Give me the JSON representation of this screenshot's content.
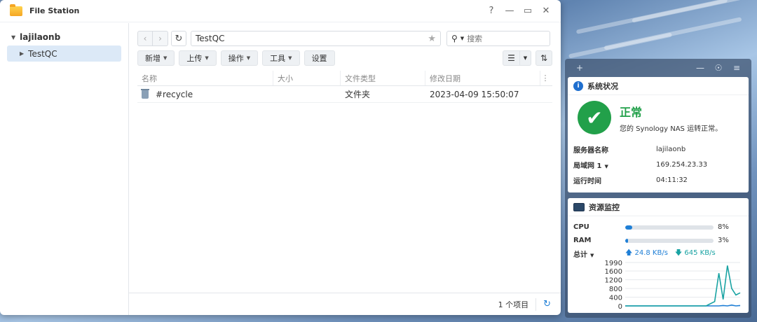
{
  "file_station": {
    "title": "File Station",
    "controls": {
      "help": "?",
      "minimize": "—",
      "maximize": "▭",
      "close": "✕"
    },
    "sidebar": {
      "root": "lajilaonb",
      "items": [
        {
          "label": "TestQC"
        }
      ]
    },
    "path": "TestQC",
    "search_placeholder": "搜索",
    "toolbar": [
      {
        "label": "新增",
        "dropdown": true
      },
      {
        "label": "上传",
        "dropdown": true
      },
      {
        "label": "操作",
        "dropdown": true
      },
      {
        "label": "工具",
        "dropdown": true
      },
      {
        "label": "设置",
        "dropdown": false
      }
    ],
    "columns": {
      "name": "名称",
      "size": "大小",
      "type": "文件类型",
      "modified": "修改日期"
    },
    "rows": [
      {
        "name": "#recycle",
        "size": "",
        "type": "文件夹",
        "modified": "2023-04-09 15:50:07",
        "icon": "trash-icon"
      }
    ],
    "status": {
      "count": "1 个项目"
    }
  },
  "system_status": {
    "title": "系统状况",
    "state": "正常",
    "description": "您的 Synology NAS 运转正常。",
    "server_name_label": "服务器名称",
    "server_name": "lajilaonb",
    "lan_label": "局域网 1",
    "lan_ip": "169.254.23.33",
    "uptime_label": "运行时间",
    "uptime": "04:11:32",
    "accent": "#22a04a"
  },
  "resource_monitor": {
    "title": "资源监控",
    "cpu_label": "CPU",
    "cpu_value": "8%",
    "cpu_fraction": 0.08,
    "ram_label": "RAM",
    "ram_value": "3%",
    "ram_fraction": 0.03,
    "total_label": "总计",
    "upload": "24.8 KB/s",
    "download": "645 KB/s"
  },
  "chart_data": {
    "type": "line",
    "title": "",
    "xlabel": "",
    "ylabel": "",
    "y_ticks": [
      1990,
      1600,
      1200,
      800,
      400,
      0
    ],
    "ylim": [
      0,
      1990
    ],
    "series": [
      {
        "color": "#1f7fd6",
        "values": [
          0,
          0,
          0,
          0,
          0,
          0,
          0,
          0,
          0,
          0,
          0,
          0,
          0,
          0,
          0,
          0,
          0,
          0,
          0,
          0,
          0,
          0,
          0,
          20,
          0,
          40,
          0,
          20
        ]
      },
      {
        "color": "#1aa3a3",
        "values": [
          0,
          0,
          0,
          0,
          0,
          0,
          0,
          0,
          0,
          0,
          0,
          0,
          0,
          0,
          0,
          0,
          0,
          0,
          0,
          0,
          100,
          200,
          1500,
          300,
          1850,
          800,
          500,
          600
        ]
      }
    ]
  }
}
